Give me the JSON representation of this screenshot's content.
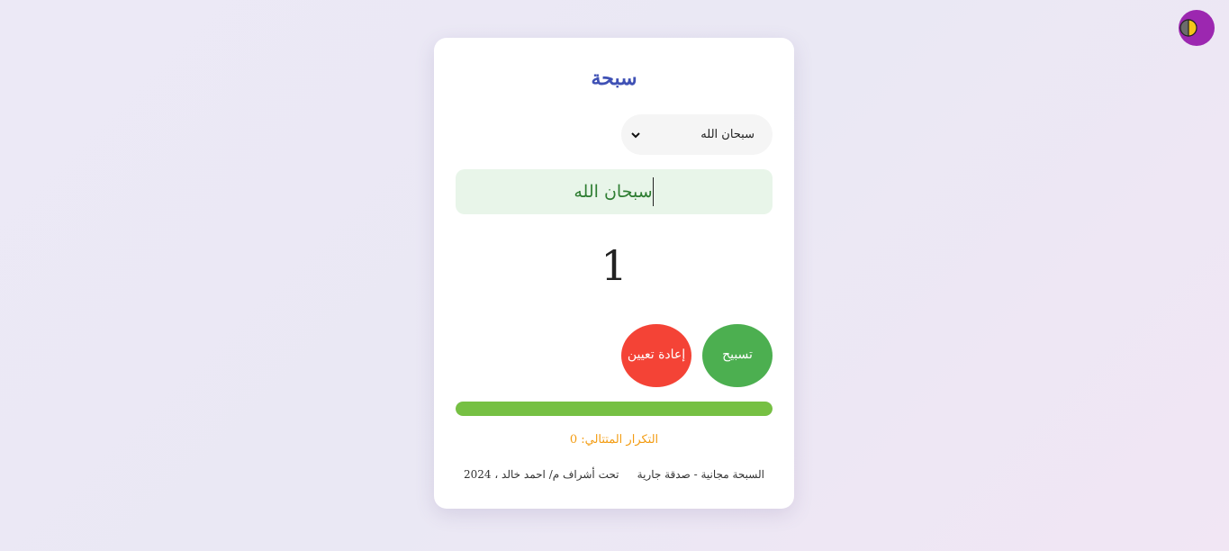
{
  "theme_toggle": {
    "icon": "half-moon-icon"
  },
  "card": {
    "title": "سبحة",
    "select": {
      "value": "سبحان الله",
      "icon": "chevron-down-icon"
    },
    "current_dhikr": "سبحان الله",
    "counter": "1",
    "buttons": {
      "count_label": "تسبيح",
      "reset_label": "إعادة تعيين"
    },
    "progress": {
      "value": 1.0,
      "color": "#76c043"
    },
    "next_repeat": "التكرار المتتالي: 0",
    "footer": {
      "left": "السبحة مجانية - صدقة جارية",
      "right": "تحت أشراف م/ احمد خالد ، 2024"
    }
  },
  "colors": {
    "title": "#3f51b5",
    "count_button": "#4caf50",
    "reset_button": "#f44336",
    "toggle": "#9c27b0",
    "next_repeat": "#f39c12"
  }
}
